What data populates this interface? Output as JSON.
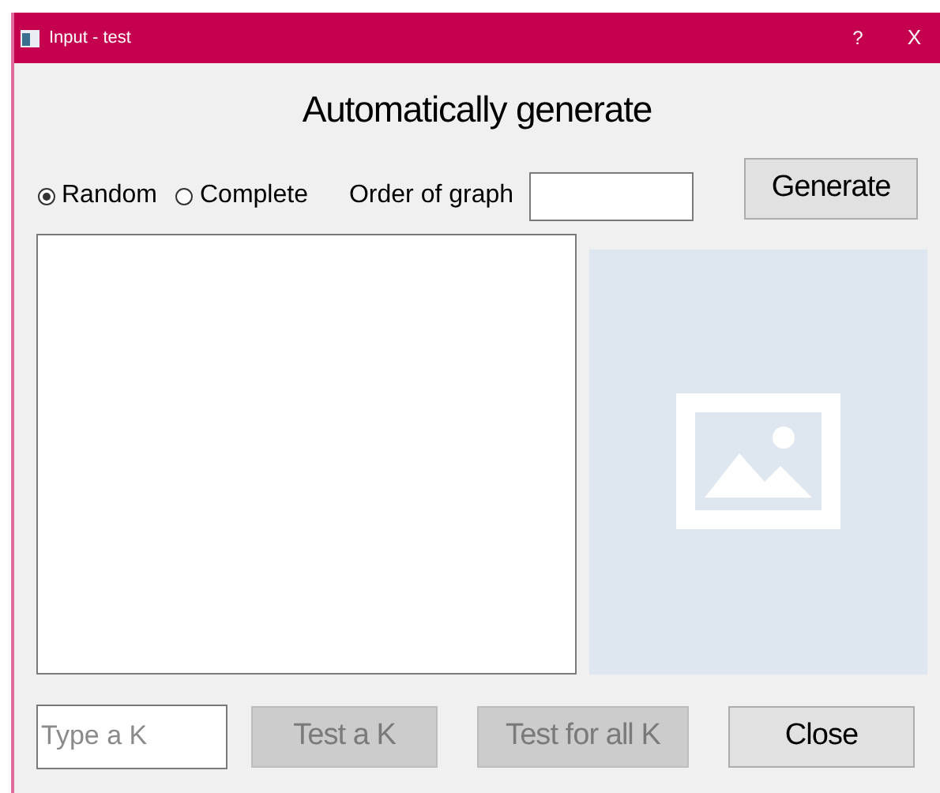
{
  "window": {
    "title": "Input - test",
    "help": "?",
    "close": "X"
  },
  "heading": "Automatically generate",
  "graph_types": [
    {
      "label": "Random",
      "selected": true
    },
    {
      "label": "Complete",
      "selected": false
    }
  ],
  "order_label": "Order of graph",
  "generate_button": {
    "label": "Generate",
    "disabled": false
  },
  "k_field": {
    "placeholder": "Type a K"
  },
  "buttons": [
    {
      "label": "Test a K",
      "disabled": true
    },
    {
      "label": "Test for all K",
      "disabled": true
    },
    {
      "label": "Close",
      "disabled": false
    }
  ]
}
